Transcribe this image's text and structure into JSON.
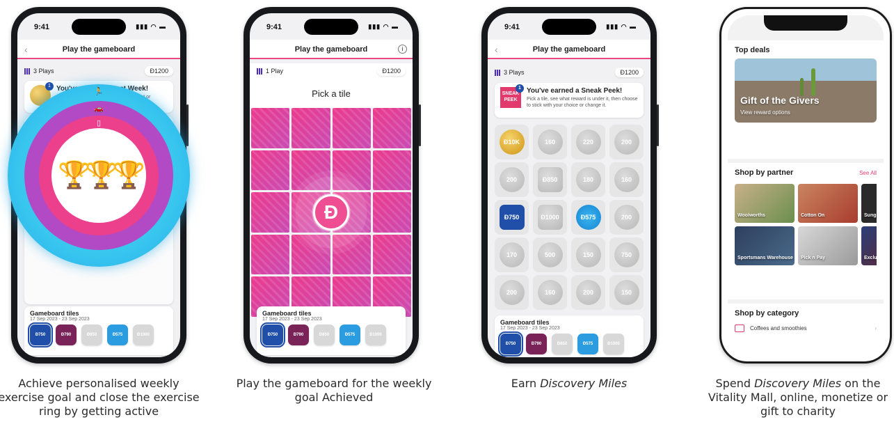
{
  "phones": [
    {
      "time": "9:41",
      "title": "Play the gameboard",
      "back": "‹",
      "plays": "3 Plays",
      "miles": "Đ1200",
      "earned_title": "You've earned a Rest Week!",
      "earned_desc": "Use it at any time to achieve your current or previous week's exercise goal.",
      "badge": "1",
      "tiles_title": "Gameboard tiles",
      "tiles_date": "17 Sep 2023 - 23 Sep 2023",
      "tiles": [
        "Đ750",
        "Đ790",
        "Đ850",
        "Đ575",
        "Đ1000"
      ]
    },
    {
      "time": "9:41",
      "title": "Play the gameboard",
      "info": "i",
      "plays": "1 Play",
      "miles": "Đ1200",
      "pick": "Pick a tile",
      "medal": "Đ",
      "tiles_title": "Gameboard tiles",
      "tiles_date": "17 Sep 2023 - 23 Sep 2023",
      "tiles": [
        "Đ750",
        "Đ790",
        "Đ850",
        "Đ575",
        "Đ1000"
      ]
    },
    {
      "time": "9:41",
      "title": "Play the gameboard",
      "back": "‹",
      "plays": "3 Plays",
      "miles": "Đ1200",
      "peek_icon": "SNEAK PEEK",
      "badge": "1",
      "earned_title": "You've earned a Sneak Peek!",
      "earned_desc": "Pick a tile, see what reward is under it, then choose to stick with your choice or change it.",
      "coins": [
        "Đ10K",
        "160",
        "220",
        "200",
        "200",
        "Đ850",
        "180",
        "160",
        "Đ750",
        "Đ1000",
        "Đ575",
        "200",
        "170",
        "500",
        "150",
        "750",
        "200",
        "160",
        "200",
        "150"
      ],
      "tiles_title": "Gameboard tiles",
      "tiles_date": "17 Sep 2023 - 23 Sep 2023",
      "tiles": [
        "Đ750",
        "Đ790",
        "Đ850",
        "Đ575",
        "Đ1000"
      ]
    },
    {
      "top_deals": "Top deals",
      "deal_title": "Gift of the Givers",
      "deal_sub": "View reward options",
      "shop_partner": "Shop by partner",
      "see_all": "See All",
      "partners": [
        "Woolworths",
        "Cotton On",
        "Sung",
        "Sportsmans Warehouse",
        "Pick n Pay",
        "Exclu"
      ],
      "shop_category": "Shop by category",
      "category_item": "Coffees and smoothies",
      "chevron": "›"
    }
  ],
  "captions": [
    "Achieve personalised weekly exercise goal and close the exercise ring by getting active",
    "Play the gameboard for the weekly goal Achieved",
    "Earn Discovery Miles",
    "Spend Discovery Miles on the Vitality Mall, online, monetize or gift to charity"
  ],
  "colors": {
    "pink": "#ec3f8c",
    "purple": "#b24ac6",
    "cyan": "#39c7ef",
    "navy": "#1f4fa8",
    "gold": "#cf9414"
  }
}
